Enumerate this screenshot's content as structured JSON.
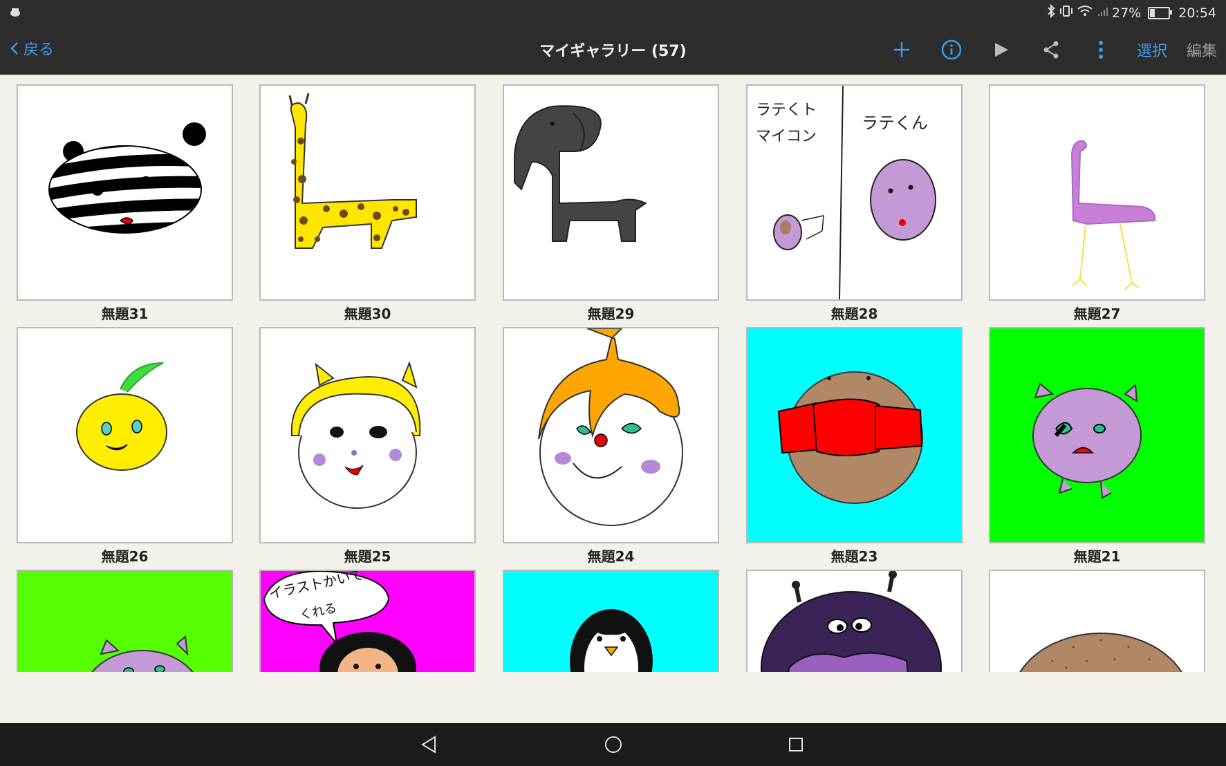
{
  "status": {
    "battery": "27%",
    "time": "20:54",
    "battery_level": 0.27
  },
  "header": {
    "back_label": "戻る",
    "title": "マイギャラリー (57)",
    "select_label": "選択",
    "edit_label": "編集"
  },
  "gallery": {
    "labels": [
      "無題31",
      "無題30",
      "無題29",
      "無題28",
      "無題27",
      "無題26",
      "無題25",
      "無題24",
      "無題23",
      "無題21"
    ],
    "drawing28_text_left_1": "ラテくト",
    "drawing28_text_left_2": "マイコン",
    "drawing28_text_right": "ラテくん",
    "bubble_text_1": "イラストかいて",
    "bubble_text_2": "くれる"
  },
  "colors": {
    "accent": "#3d9be9",
    "bar": "#2d2d2d",
    "background": "#f3f2ea",
    "cyan": "#00ffff",
    "green": "#00ff00",
    "lime": "#55ff00",
    "magenta": "#ff00ff"
  }
}
